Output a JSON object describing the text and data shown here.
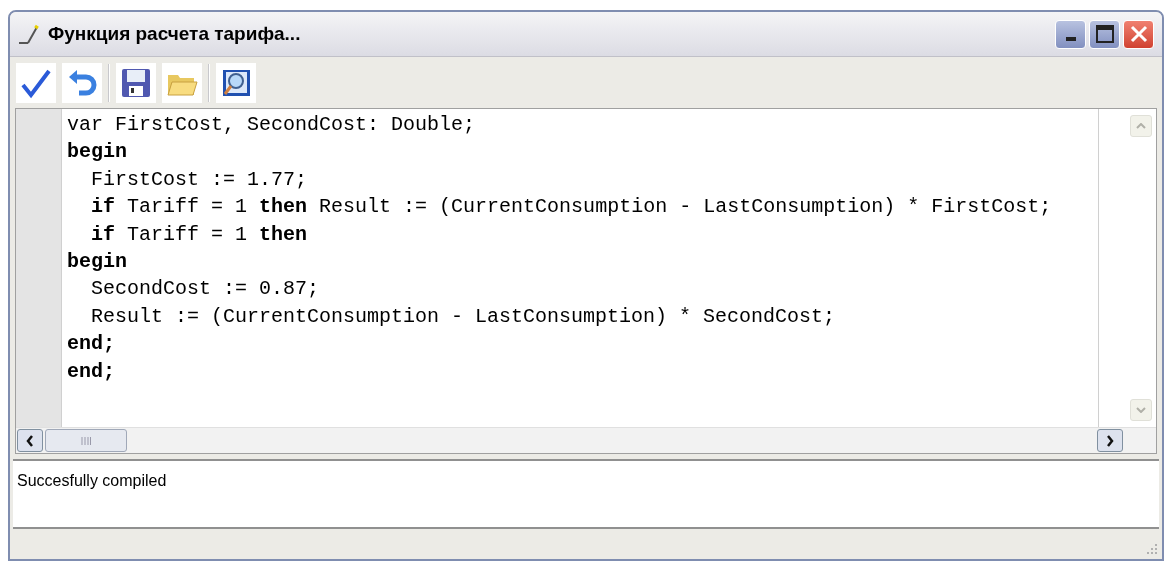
{
  "window": {
    "title": "Функция расчета тарифа..."
  },
  "toolbar": [
    {
      "kind": "check"
    },
    {
      "kind": "undo"
    },
    {
      "kind": "separator"
    },
    {
      "kind": "save"
    },
    {
      "kind": "open"
    },
    {
      "kind": "separator"
    },
    {
      "kind": "preview"
    }
  ],
  "code_lines": [
    {
      "text": "var FirstCost, SecondCost: Double;",
      "bold": false
    },
    {
      "text": "begin",
      "bold": true
    },
    {
      "text": "  FirstCost := 1.77;",
      "bold": false
    },
    {
      "text": "  **if** Tariff = 1 **then** Result := (CurrentConsumption - LastConsumption) * FirstCost;",
      "bold": false
    },
    {
      "text": "  **if** Tariff = 1 **then**",
      "bold": false
    },
    {
      "text": "begin",
      "bold": true
    },
    {
      "text": "  SecondCost := 0.87;",
      "bold": false
    },
    {
      "text": "  Result := (CurrentConsumption - LastConsumption) * SecondCost;",
      "bold": false
    },
    {
      "text": "end;",
      "bold": true
    },
    {
      "text": "end;",
      "bold": true
    }
  ],
  "output": {
    "message": "Succesfully compiled"
  }
}
